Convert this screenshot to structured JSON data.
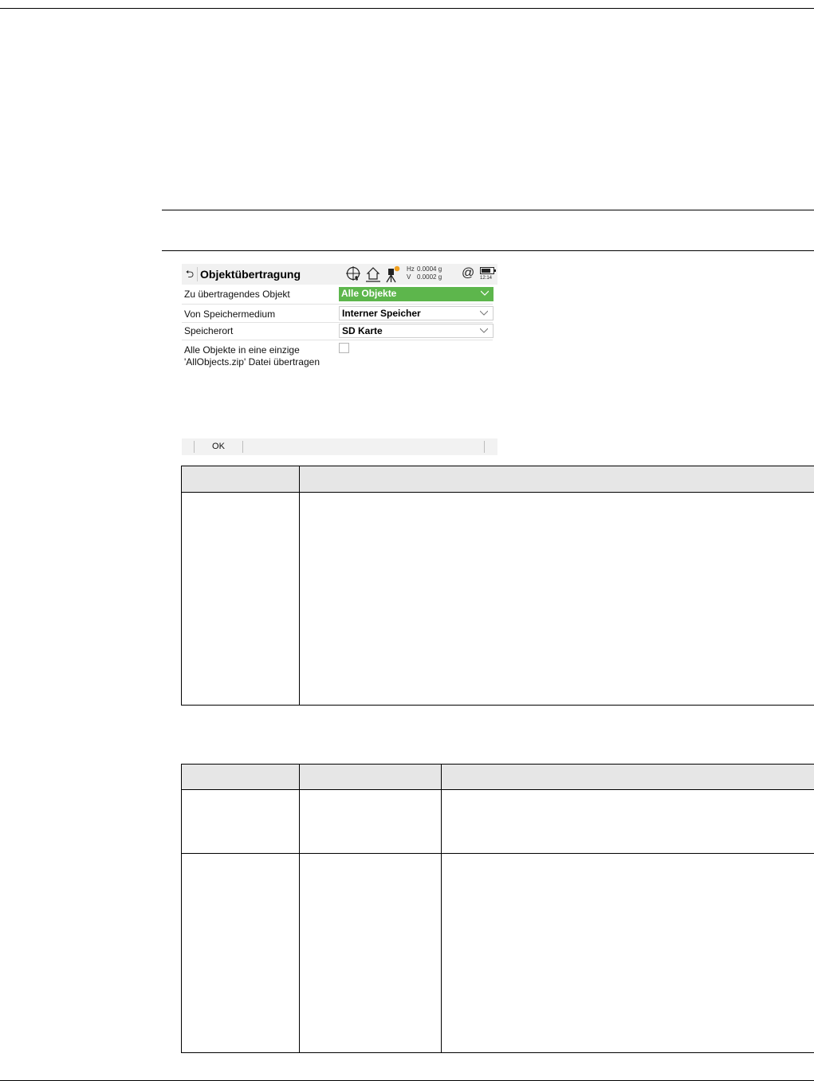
{
  "screen": {
    "title": "Objektübertragung",
    "status": {
      "hz_label": "Hz",
      "hz_value": "0.0004 g",
      "v_label": "V",
      "v_value": "0.0002 g",
      "time": "12:14"
    },
    "rows": [
      {
        "label": "Zu übertragendes Objekt",
        "value": "Alle Objekte"
      },
      {
        "label": "Von Speichermedium",
        "value": "Interner Speicher"
      },
      {
        "label": "Speicherort",
        "value": "SD Karte"
      }
    ],
    "checkbox": {
      "label_line1": "Alle Objekte in eine einzige",
      "label_line2": "'AllObjects.zip' Datei übertragen",
      "checked": false
    },
    "softkeys": {
      "ok": "OK"
    },
    "accent_color": "#5db64c"
  }
}
